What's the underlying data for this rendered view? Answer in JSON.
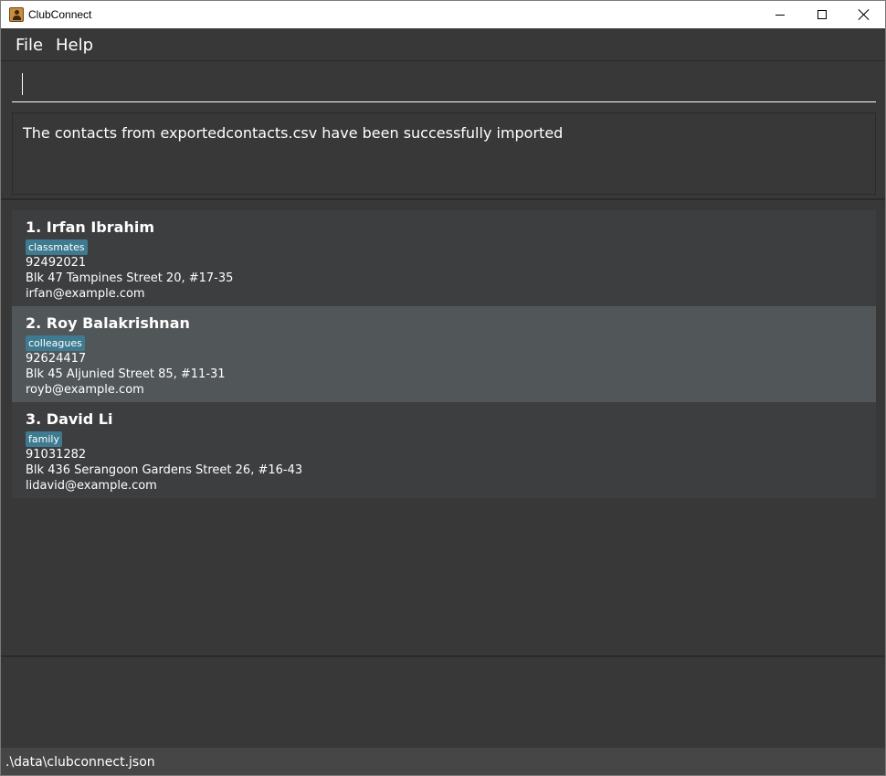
{
  "window": {
    "title": "ClubConnect",
    "icon": "app-icon"
  },
  "menu": {
    "items": [
      {
        "label": "File"
      },
      {
        "label": "Help"
      }
    ]
  },
  "command": {
    "value": "",
    "placeholder": ""
  },
  "result": {
    "message": "The contacts from exportedcontacts.csv have been successfully imported"
  },
  "persons": [
    {
      "index_name": "1. Irfan Ibrahim",
      "tag": "classmates",
      "phone": "92492021",
      "address": "Blk 47 Tampines Street 20, #17-35",
      "email": "irfan@example.com"
    },
    {
      "index_name": "2. Roy Balakrishnan",
      "tag": "colleagues",
      "phone": "92624417",
      "address": "Blk 45 Aljunied Street 85, #11-31",
      "email": "royb@example.com"
    },
    {
      "index_name": "3. David Li",
      "tag": "family",
      "phone": "91031282",
      "address": "Blk 436 Serangoon Gardens Street 26, #16-43",
      "email": "lidavid@example.com"
    }
  ],
  "status": {
    "file_path": ".\\data\\clubconnect.json"
  },
  "colors": {
    "background": "#383838",
    "card": "#3c3e3f",
    "card_selected": "#515658",
    "tag": "#3e7b91"
  }
}
